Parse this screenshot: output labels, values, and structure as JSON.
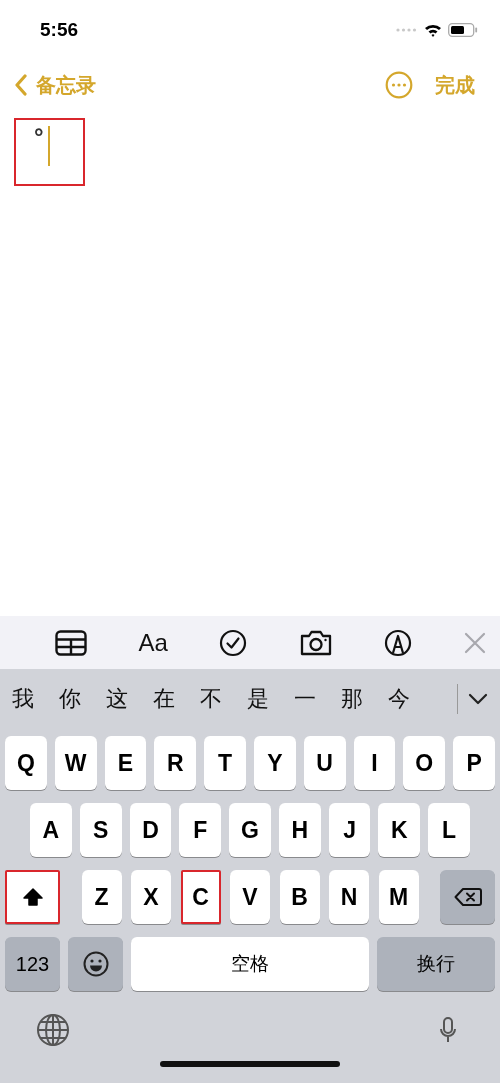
{
  "status_bar": {
    "time": "5:56"
  },
  "nav": {
    "back_label": "备忘录",
    "done_label": "完成"
  },
  "note": {
    "text": "°",
    "highlighted": true
  },
  "toolbar": {
    "format_label": "Aa"
  },
  "candidates": [
    "我",
    "你",
    "这",
    "在",
    "不",
    "是",
    "一",
    "那",
    "今"
  ],
  "keyboard": {
    "rows": [
      [
        {
          "kind": "letter",
          "label": "Q",
          "highlighted": false
        },
        {
          "kind": "letter",
          "label": "W",
          "highlighted": false
        },
        {
          "kind": "letter",
          "label": "E",
          "highlighted": false
        },
        {
          "kind": "letter",
          "label": "R",
          "highlighted": false
        },
        {
          "kind": "letter",
          "label": "T",
          "highlighted": false
        },
        {
          "kind": "letter",
          "label": "Y",
          "highlighted": false
        },
        {
          "kind": "letter",
          "label": "U",
          "highlighted": false
        },
        {
          "kind": "letter",
          "label": "I",
          "highlighted": false
        },
        {
          "kind": "letter",
          "label": "O",
          "highlighted": false
        },
        {
          "kind": "letter",
          "label": "P",
          "highlighted": false
        }
      ],
      [
        {
          "kind": "letter",
          "label": "A",
          "highlighted": false
        },
        {
          "kind": "letter",
          "label": "S",
          "highlighted": false
        },
        {
          "kind": "letter",
          "label": "D",
          "highlighted": false
        },
        {
          "kind": "letter",
          "label": "F",
          "highlighted": false
        },
        {
          "kind": "letter",
          "label": "G",
          "highlighted": false
        },
        {
          "kind": "letter",
          "label": "H",
          "highlighted": false
        },
        {
          "kind": "letter",
          "label": "J",
          "highlighted": false
        },
        {
          "kind": "letter",
          "label": "K",
          "highlighted": false
        },
        {
          "kind": "letter",
          "label": "L",
          "highlighted": false
        }
      ],
      [
        {
          "kind": "shift",
          "on": true,
          "highlighted": true
        },
        {
          "kind": "letter",
          "label": "Z",
          "highlighted": false
        },
        {
          "kind": "letter",
          "label": "X",
          "highlighted": false
        },
        {
          "kind": "letter",
          "label": "C",
          "highlighted": true
        },
        {
          "kind": "letter",
          "label": "V",
          "highlighted": false
        },
        {
          "kind": "letter",
          "label": "B",
          "highlighted": false
        },
        {
          "kind": "letter",
          "label": "N",
          "highlighted": false
        },
        {
          "kind": "letter",
          "label": "M",
          "highlighted": false
        },
        {
          "kind": "delete",
          "highlighted": false
        }
      ]
    ],
    "bottom_row": [
      {
        "kind": "numbers",
        "label": "123",
        "highlighted": false
      },
      {
        "kind": "emoji",
        "highlighted": false
      },
      {
        "kind": "space",
        "label": "空格",
        "highlighted": false
      },
      {
        "kind": "return",
        "label": "换行",
        "highlighted": false
      }
    ]
  }
}
